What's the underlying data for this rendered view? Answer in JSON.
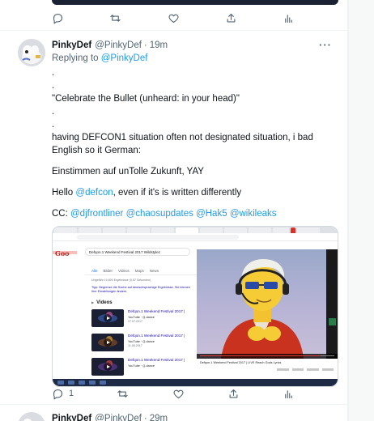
{
  "tweet": {
    "display_name": "PinkyDef",
    "handle": "@PinkyDef",
    "separator": "·",
    "time": "19m",
    "more_label": "···",
    "replying_prefix": "Replying to",
    "replying_handle": "@PinkyDef",
    "lines": {
      "dot1": ".",
      "dot2": ".",
      "quote": "\"Celebrate the Bullet (unheard: in your head)\"",
      "dot3": ".",
      "dot4": ".",
      "defcon_line": "having DEFCON1 situation often not designated situation, i bad English so it German:",
      "german": "Einstimmen auf unTolle Zukunft, YAY",
      "hello_prefix": "Hello ",
      "hello_mention": "@defcon",
      "hello_suffix": ", even if it's is written differently",
      "cc_prefix": "CC: ",
      "cc_mentions": [
        "@djfrontliner",
        "@chaosupdates",
        "@Hak5",
        "@wikileaks"
      ]
    },
    "reply_count": "1",
    "retweet_count": "",
    "like_count": ""
  },
  "media": {
    "search_query": "Defqon.1 Weekend Festival 2017 Wildstylez",
    "serp_tabs": [
      "Alle",
      "Bilder",
      "Videos",
      "Maps",
      "News"
    ],
    "result_stats": "Ungefähr 10.800 Ergebnisse (0,57 Sekunden)",
    "correction_text": "Tipp: Begrenze die Suche auf deutschsprachige Ergebnisse. Sie können Ihre Einstellungen ändern.",
    "videos_heading": "Videos",
    "videos": [
      {
        "title": "Defqon.1 Weekend Festival 2017 |",
        "source": "YouTube · Q-dance",
        "date": "27.07.2017"
      },
      {
        "title": "Defqon.1 Weekend Festival 2017 |",
        "source": "YouTube · Q-dance",
        "date": "11.08.2017"
      },
      {
        "title": "Defqon.1 Weekend Festival 2017 |",
        "source": "YouTube · Q-dance",
        "date": ""
      }
    ],
    "player_caption": "Defqon.1 Weekend Festival 2017 | LIVE Reach Gods Lyrics",
    "player_progress": 0.9
  },
  "next_tweet": {
    "display_name": "PinkyDef",
    "handle": "@PinkyDef",
    "separator": "·",
    "time": "29m"
  },
  "colors": {
    "link": "#1d9bf0",
    "text": "#0f1419",
    "muted": "#536471",
    "border": "#eff3f4"
  },
  "icons": [
    "reply-icon",
    "retweet-icon",
    "like-icon",
    "share-icon",
    "analytics-icon"
  ]
}
